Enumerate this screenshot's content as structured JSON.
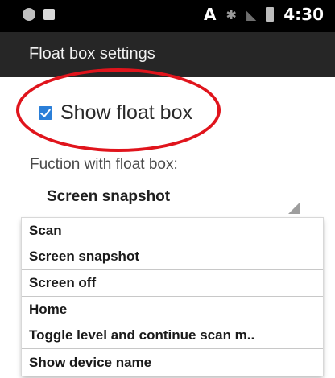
{
  "status_bar": {
    "time": "4:30",
    "a_glyph": "A",
    "bluetooth_glyph": "✱",
    "signal_glyph": "◣"
  },
  "app_bar": {
    "title": "Float box settings"
  },
  "settings": {
    "show_float_box": {
      "label": "Show float box",
      "checked": true
    },
    "function_label": "Fuction with float box:",
    "spinner_value": "Screen snapshot"
  },
  "dropdown": {
    "options": [
      "Scan",
      "Screen snapshot",
      "Screen off",
      "Home",
      "Toggle level and continue scan m..",
      "Show device name"
    ]
  },
  "colors": {
    "accent": "#2b7fd8",
    "highlight": "#e0141c",
    "app_bar": "#262626",
    "status_bar": "#000000"
  }
}
